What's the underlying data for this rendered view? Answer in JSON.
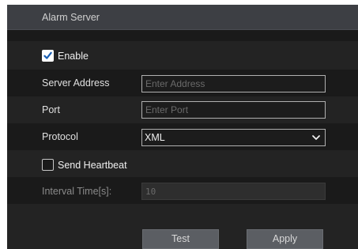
{
  "dialog": {
    "title": "Alarm Server"
  },
  "enable": {
    "label": "Enable",
    "checked": true
  },
  "server_address": {
    "label": "Server Address",
    "value": "",
    "placeholder": "Enter Address"
  },
  "port": {
    "label": "Port",
    "value": "",
    "placeholder": "Enter Port"
  },
  "protocol": {
    "label": "Protocol",
    "selected": "XML"
  },
  "send_heartbeat": {
    "label": "Send Heartbeat",
    "checked": false
  },
  "interval": {
    "label": "Interval Time[s]:",
    "value": "10",
    "disabled": true
  },
  "buttons": {
    "test": "Test",
    "apply": "Apply"
  },
  "icons": {
    "check": "checkmark-icon",
    "dropdown": "chevron-down-icon"
  }
}
